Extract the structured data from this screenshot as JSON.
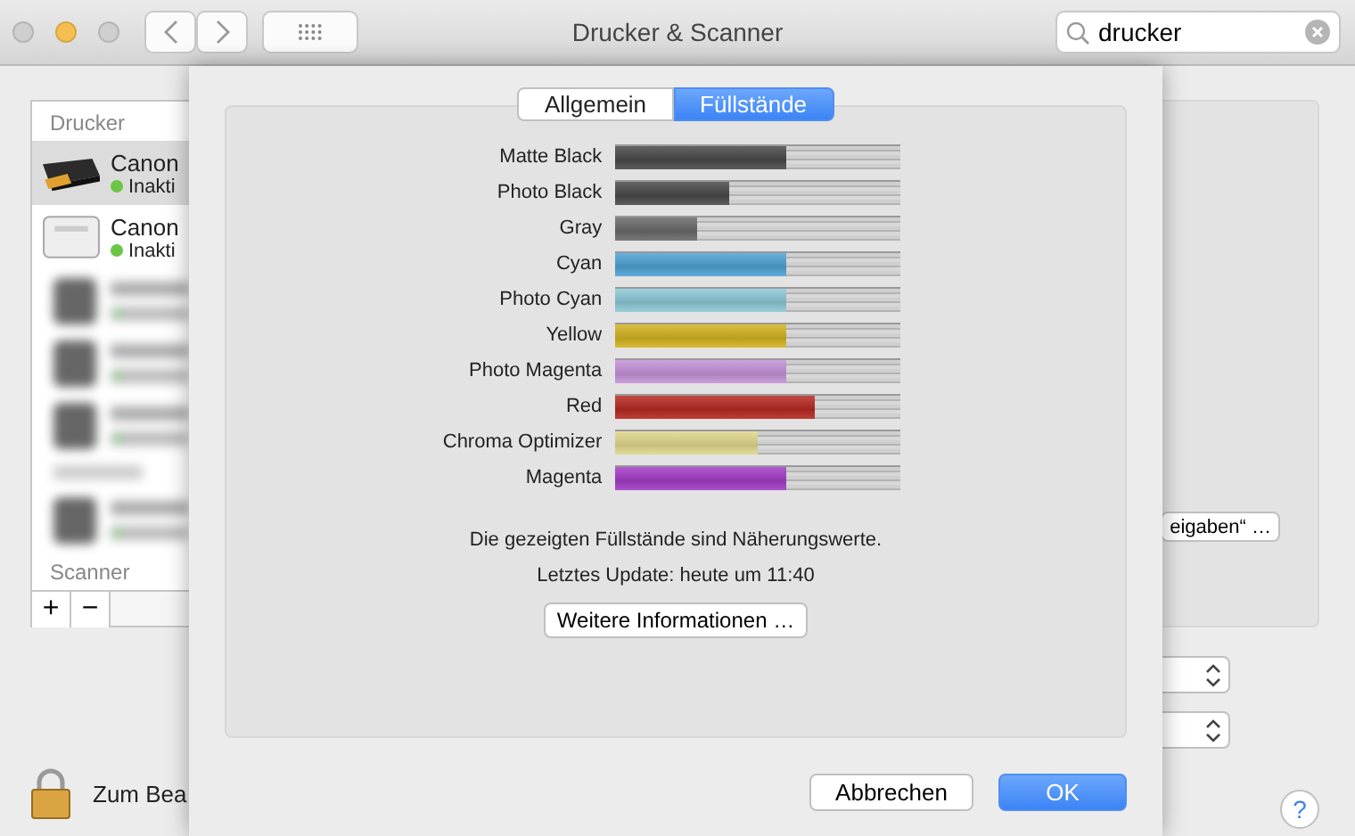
{
  "window": {
    "title": "Drucker & Scanner"
  },
  "search": {
    "value": "drucker"
  },
  "sidebar": {
    "header": "Drucker",
    "items": [
      {
        "kind": "printer",
        "name": "Canon",
        "status": "Inakti",
        "selected": true
      },
      {
        "kind": "printer",
        "name": "Canon",
        "status": "Inakti",
        "selected": false
      },
      {
        "kind": "blurred"
      },
      {
        "kind": "blurred"
      },
      {
        "kind": "blurred"
      },
      {
        "kind": "blurred_section"
      },
      {
        "kind": "blurred"
      }
    ],
    "section": "Scanner",
    "buttons": [
      "+",
      "−"
    ]
  },
  "options_button": "eigaben“ …",
  "lock_label": "Zum Bea",
  "help": "?",
  "sheet": {
    "tabs": [
      {
        "label": "Allgemein",
        "selected": false
      },
      {
        "label": "Füllstände",
        "selected": true
      }
    ],
    "inks": [
      {
        "name": "Matte Black",
        "color": "#4a4a4a",
        "level": 0.6
      },
      {
        "name": "Photo Black",
        "color": "#4a4a4a",
        "level": 0.4
      },
      {
        "name": "Gray",
        "color": "#6a6a6a",
        "level": 0.29
      },
      {
        "name": "Cyan",
        "color": "#4fa3d6",
        "level": 0.6
      },
      {
        "name": "Photo Cyan",
        "color": "#8ec9d8",
        "level": 0.6
      },
      {
        "name": "Yellow",
        "color": "#d4b420",
        "level": 0.6
      },
      {
        "name": "Photo Magenta",
        "color": "#c592d8",
        "level": 0.6
      },
      {
        "name": "Red",
        "color": "#b82a22",
        "level": 0.7
      },
      {
        "name": "Chroma Optimizer",
        "color": "#e0d88e",
        "level": 0.5
      },
      {
        "name": "Magenta",
        "color": "#a43cc8",
        "level": 0.6
      }
    ],
    "note": "Die gezeigten Füllstände sind Näherungswerte.",
    "update": "Letztes Update: heute um 11:40",
    "info_button": "Weitere Informationen …",
    "cancel": "Abbrechen",
    "ok": "OK"
  }
}
